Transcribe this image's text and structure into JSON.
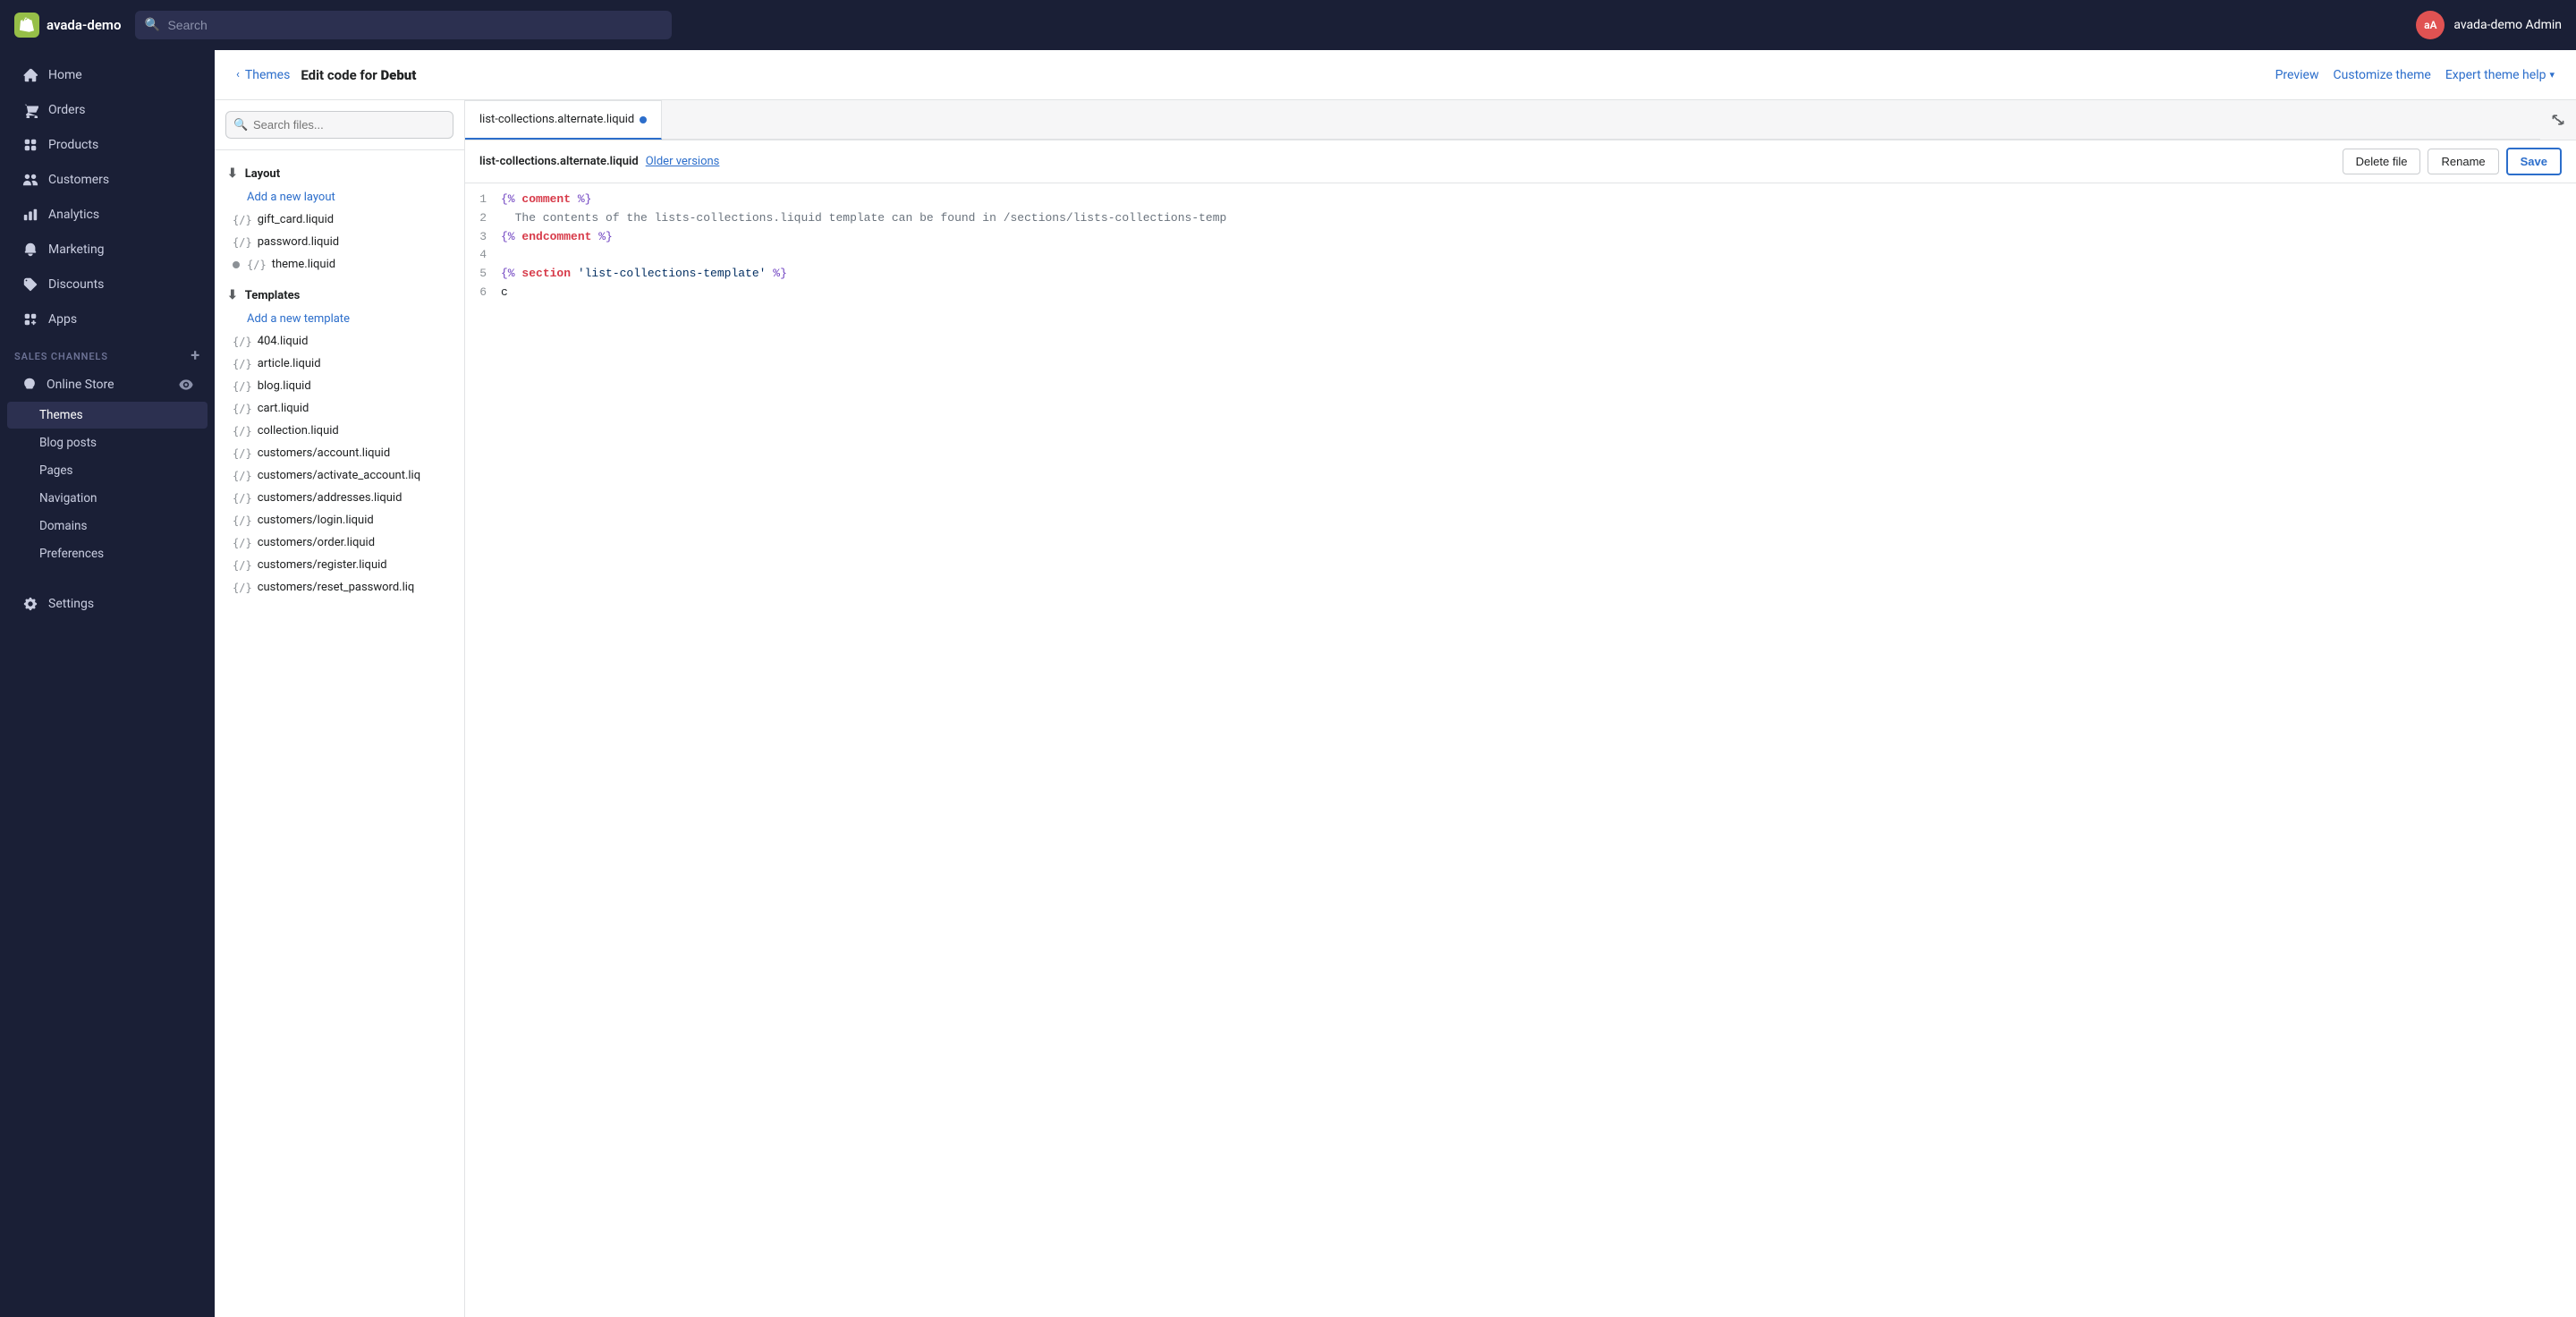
{
  "topNav": {
    "brand": "avada-demo",
    "searchPlaceholder": "Search",
    "avatarText": "aA",
    "adminName": "avada-demo Admin"
  },
  "sidebar": {
    "navItems": [
      {
        "id": "home",
        "label": "Home",
        "icon": "home"
      },
      {
        "id": "orders",
        "label": "Orders",
        "icon": "orders"
      },
      {
        "id": "products",
        "label": "Products",
        "icon": "products"
      },
      {
        "id": "customers",
        "label": "Customers",
        "icon": "customers"
      },
      {
        "id": "analytics",
        "label": "Analytics",
        "icon": "analytics"
      },
      {
        "id": "marketing",
        "label": "Marketing",
        "icon": "marketing"
      },
      {
        "id": "discounts",
        "label": "Discounts",
        "icon": "discounts"
      },
      {
        "id": "apps",
        "label": "Apps",
        "icon": "apps"
      }
    ],
    "salesChannelsLabel": "SALES CHANNELS",
    "onlineStoreLabel": "Online Store",
    "subItems": [
      {
        "id": "themes",
        "label": "Themes",
        "active": true
      },
      {
        "id": "blog-posts",
        "label": "Blog posts",
        "active": false
      },
      {
        "id": "pages",
        "label": "Pages",
        "active": false
      },
      {
        "id": "navigation",
        "label": "Navigation",
        "active": false
      },
      {
        "id": "domains",
        "label": "Domains",
        "active": false
      },
      {
        "id": "preferences",
        "label": "Preferences",
        "active": false
      }
    ],
    "settingsLabel": "Settings"
  },
  "subHeader": {
    "breadcrumbLink": "Themes",
    "breadcrumbText": "Edit code for ",
    "breadcrumbBold": "Debut",
    "previewLabel": "Preview",
    "customizeThemeLabel": "Customize theme",
    "expertThemeHelpLabel": "Expert theme help"
  },
  "filePanel": {
    "searchPlaceholder": "Search files...",
    "sections": [
      {
        "id": "layout",
        "label": "Layout",
        "addLink": "Add a new layout",
        "files": [
          {
            "name": "gift_card.liquid",
            "modified": false
          },
          {
            "name": "password.liquid",
            "modified": false
          },
          {
            "name": "theme.liquid",
            "modified": true
          }
        ]
      },
      {
        "id": "templates",
        "label": "Templates",
        "addLink": "Add a new template",
        "files": [
          {
            "name": "404.liquid",
            "modified": false
          },
          {
            "name": "article.liquid",
            "modified": false
          },
          {
            "name": "blog.liquid",
            "modified": false
          },
          {
            "name": "cart.liquid",
            "modified": false
          },
          {
            "name": "collection.liquid",
            "modified": false
          },
          {
            "name": "customers/account.liquid",
            "modified": false
          },
          {
            "name": "customers/activate_account.liq",
            "modified": false
          },
          {
            "name": "customers/addresses.liquid",
            "modified": false
          },
          {
            "name": "customers/login.liquid",
            "modified": false
          },
          {
            "name": "customers/order.liquid",
            "modified": false
          },
          {
            "name": "customers/register.liquid",
            "modified": false
          },
          {
            "name": "customers/reset_password.liq",
            "modified": false
          }
        ]
      }
    ]
  },
  "editor": {
    "tabFilename": "list-collections.alternate.liquid",
    "tabHasChanges": true,
    "toolbarFilename": "list-collections.alternate.liquid",
    "olderVersionsLabel": "Older versions",
    "deleteFileLabel": "Delete file",
    "renameLabel": "Rename",
    "saveLabel": "Save",
    "codeLines": [
      {
        "num": 1,
        "tokens": [
          {
            "type": "tag",
            "text": "{%"
          },
          {
            "type": "keyword",
            "text": " comment "
          },
          {
            "type": "tag",
            "text": "%}"
          }
        ]
      },
      {
        "num": 2,
        "tokens": [
          {
            "type": "comment",
            "text": "  The contents of the lists-collections.liquid template can be found in /sections/lists-collections-temp"
          }
        ]
      },
      {
        "num": 3,
        "tokens": [
          {
            "type": "tag",
            "text": "{%"
          },
          {
            "type": "keyword",
            "text": " endcomment "
          },
          {
            "type": "tag",
            "text": "%}"
          }
        ]
      },
      {
        "num": 4,
        "tokens": [
          {
            "type": "text",
            "text": ""
          }
        ]
      },
      {
        "num": 5,
        "tokens": [
          {
            "type": "tag",
            "text": "{%"
          },
          {
            "type": "keyword",
            "text": " section "
          },
          {
            "type": "string",
            "text": "'list-collections-template'"
          },
          {
            "type": "tag",
            "text": " %}"
          }
        ]
      },
      {
        "num": 6,
        "tokens": [
          {
            "type": "text",
            "text": "c"
          }
        ]
      }
    ]
  }
}
